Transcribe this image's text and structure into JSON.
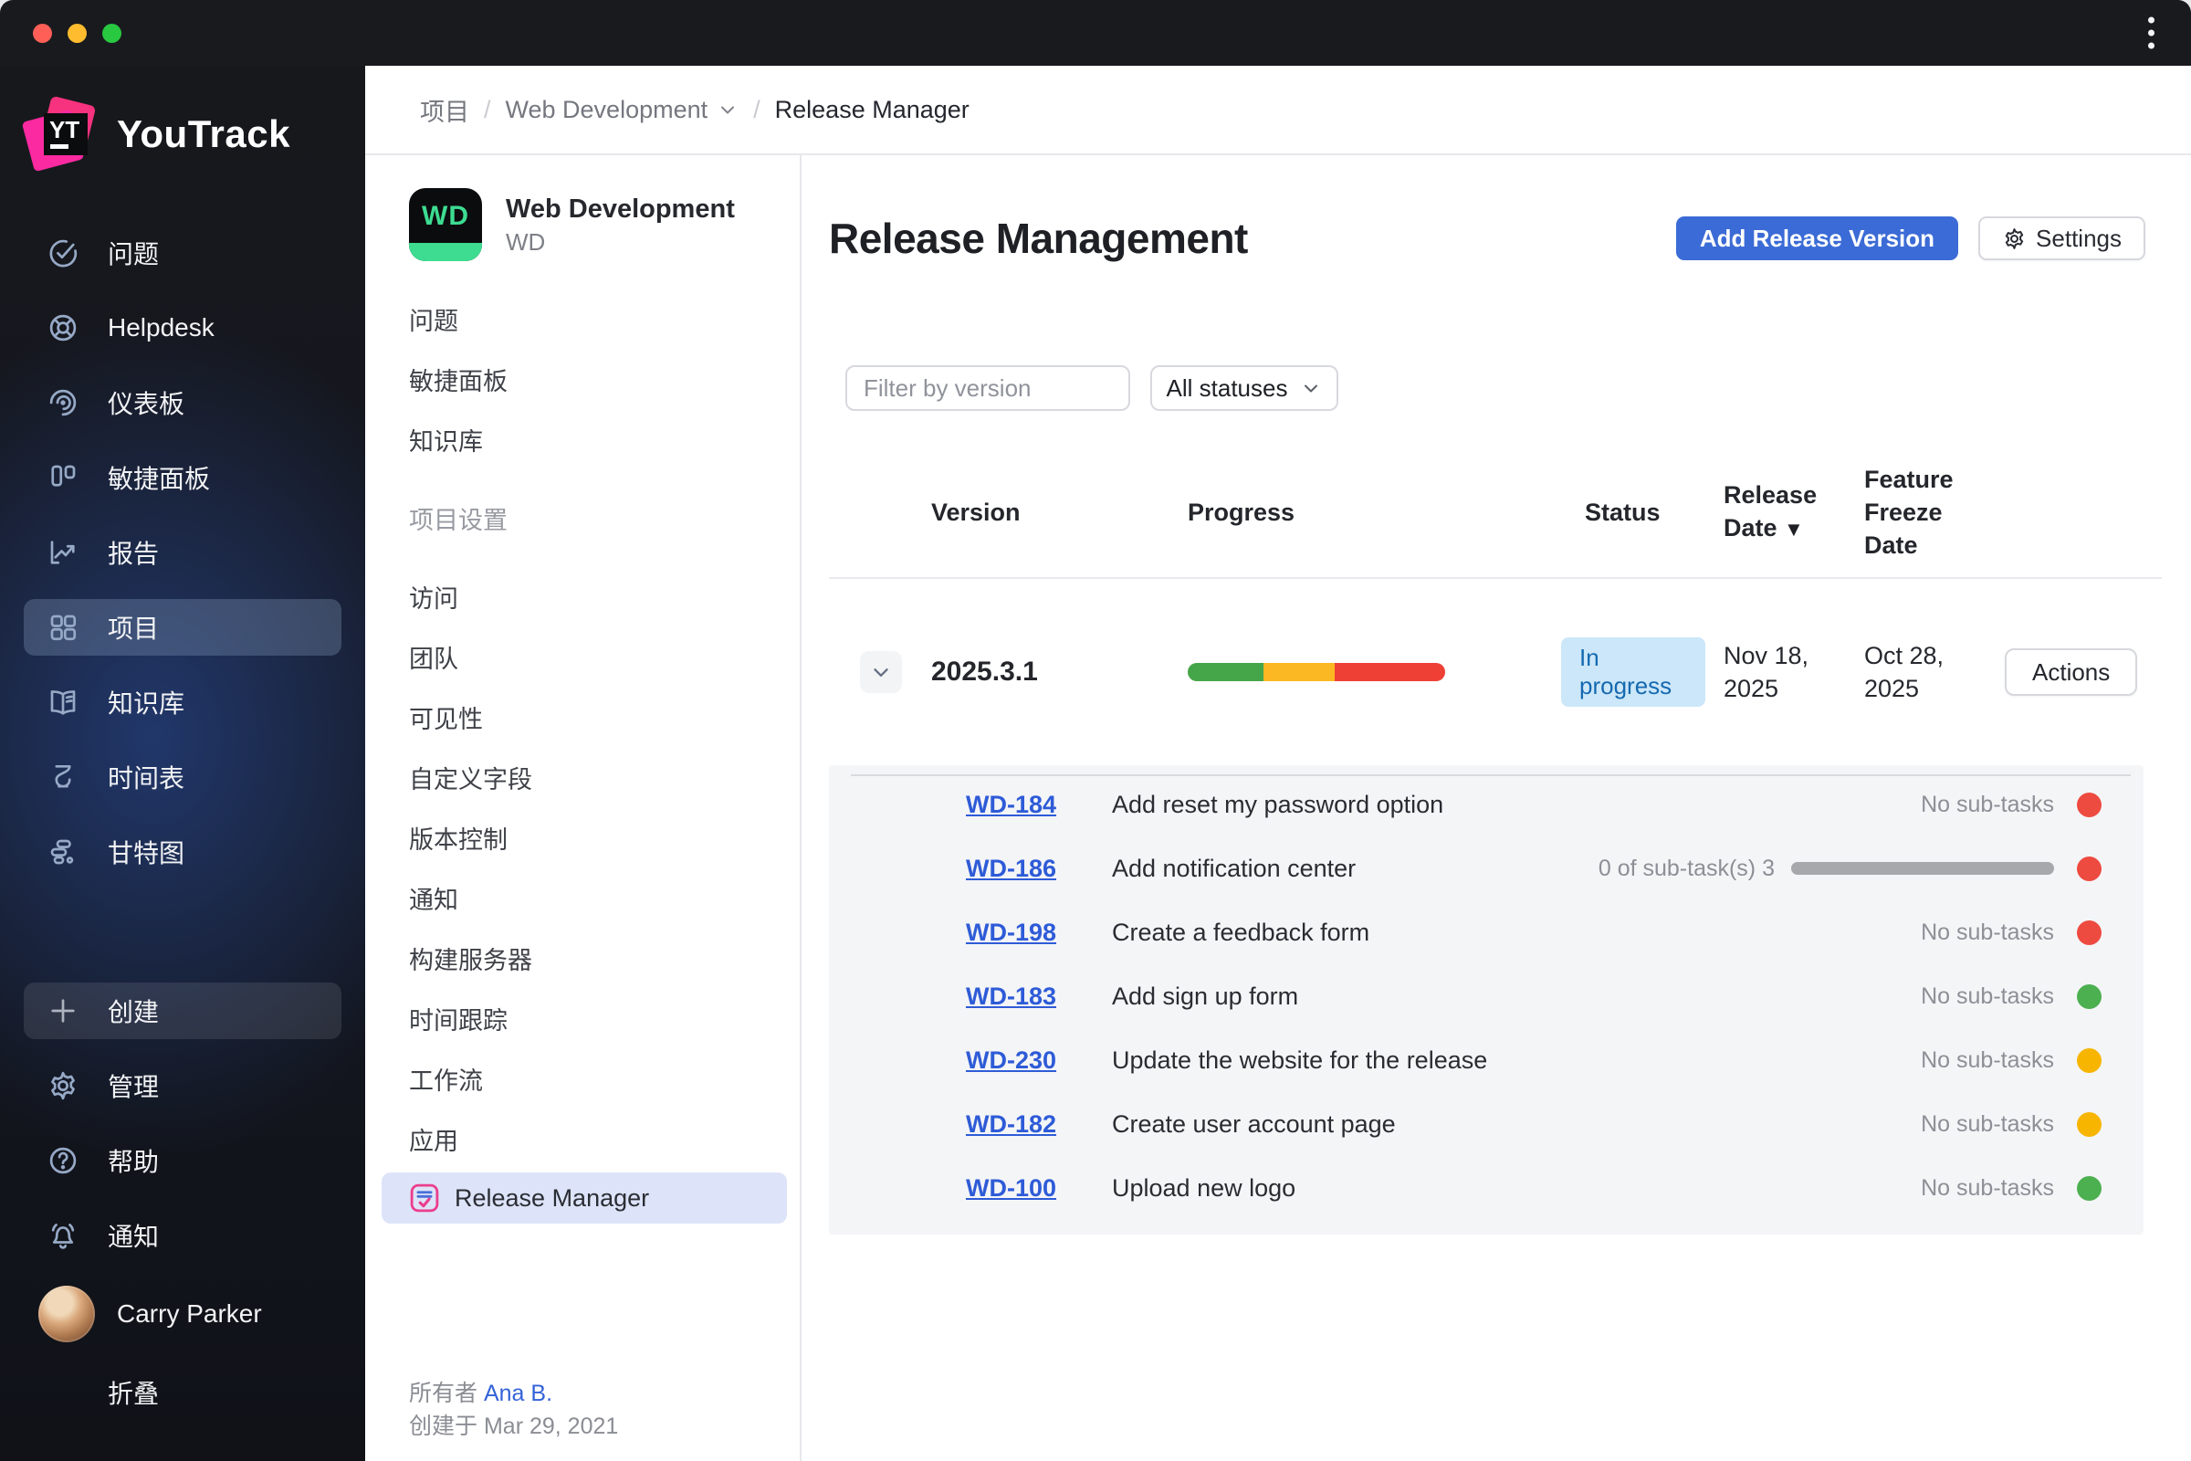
{
  "window": {
    "traffic_lights": [
      "#ff5f57",
      "#febc2e",
      "#28c840"
    ]
  },
  "app": {
    "name": "YouTrack",
    "logo_mark": "YT"
  },
  "sidebar": {
    "items": [
      {
        "icon": "check-circle",
        "label": "问题"
      },
      {
        "icon": "lifebuoy",
        "label": "Helpdesk"
      },
      {
        "icon": "dashboard-gauge",
        "label": "仪表板"
      },
      {
        "icon": "agile-board",
        "label": "敏捷面板"
      },
      {
        "icon": "report-chart",
        "label": "报告"
      },
      {
        "icon": "projects-grid",
        "label": "项目",
        "selected": true
      },
      {
        "icon": "knowledge-book",
        "label": "知识库"
      },
      {
        "icon": "hourglass",
        "label": "时间表"
      },
      {
        "icon": "gantt-bars",
        "label": "甘特图"
      }
    ],
    "footer_items": [
      {
        "icon": "plus",
        "label": "创建",
        "highlight": true
      },
      {
        "icon": "gear",
        "label": "管理"
      },
      {
        "icon": "question-circle",
        "label": "帮助"
      },
      {
        "icon": "bell",
        "label": "通知"
      }
    ],
    "user": {
      "name": "Carry Parker"
    },
    "collapse": {
      "icon": "collapse-chevrons",
      "label": "折叠"
    }
  },
  "breadcrumb": {
    "projects": "项目",
    "separator": "/",
    "project": "Web Development",
    "page": "Release Manager"
  },
  "project_panel": {
    "avatar_text": "WD",
    "name": "Web Development",
    "key": "WD",
    "nav_items": [
      {
        "label": "问题"
      },
      {
        "label": "敏捷面板"
      },
      {
        "label": "知识库"
      }
    ],
    "settings_section_title": "项目设置",
    "settings_items": [
      {
        "label": "访问"
      },
      {
        "label": "团队"
      },
      {
        "label": "可见性"
      },
      {
        "label": "自定义字段"
      },
      {
        "label": "版本控制"
      },
      {
        "label": "通知"
      },
      {
        "label": "构建服务器"
      },
      {
        "label": "时间跟踪"
      },
      {
        "label": "工作流"
      },
      {
        "label": "应用"
      }
    ],
    "selected_app": "Release Manager",
    "owner_label": "所有者",
    "owner_name": "Ana B.",
    "created_label": "创建于",
    "created_date": "Mar 29, 2021"
  },
  "main": {
    "title": "Release Management",
    "add_button": "Add Release Version",
    "settings_button": "Settings",
    "filter_placeholder": "Filter by version",
    "status_filter_value": "All statuses",
    "table": {
      "headers": {
        "version": "Version",
        "progress": "Progress",
        "status": "Status",
        "release_date": "Release Date",
        "sort_indicator": "▼",
        "feature_freeze": "Feature Freeze Date"
      },
      "release": {
        "version": "2025.3.1",
        "progress_segments": [
          {
            "color": "progress_green",
            "percent": 29.5
          },
          {
            "color": "progress_yellow",
            "percent": 27.5
          },
          {
            "color": "progress_red",
            "percent": 43
          }
        ],
        "status": "In progress",
        "release_date": "Nov 18, 2025",
        "feature_freeze_date": "Oct 28, 2025",
        "actions_label": "Actions"
      },
      "tasks": [
        {
          "id": "WD-184",
          "title": "Add reset my password option",
          "subtask_label": "No sub-tasks",
          "has_bar": false,
          "dot": "dot_red"
        },
        {
          "id": "WD-186",
          "title": "Add notification center",
          "subtask_label": "0 of sub-task(s) 3",
          "has_bar": true,
          "dot": "dot_red"
        },
        {
          "id": "WD-198",
          "title": "Create a feedback form",
          "subtask_label": "No sub-tasks",
          "has_bar": false,
          "dot": "dot_red"
        },
        {
          "id": "WD-183",
          "title": "Add sign up form",
          "subtask_label": "No sub-tasks",
          "has_bar": false,
          "dot": "dot_green"
        },
        {
          "id": "WD-230",
          "title": "Update the website for the release",
          "subtask_label": "No sub-tasks",
          "has_bar": false,
          "dot": "dot_yellow"
        },
        {
          "id": "WD-182",
          "title": "Create user account page",
          "subtask_label": "No sub-tasks",
          "has_bar": false,
          "dot": "dot_yellow"
        },
        {
          "id": "WD-100",
          "title": "Upload new logo",
          "subtask_label": "No sub-tasks",
          "has_bar": false,
          "dot": "dot_green"
        }
      ]
    }
  },
  "colors": {
    "accent_blue": "#3b6bd6",
    "badge_bg": "#cbe7f9",
    "badge_text": "#1569b0",
    "link_blue": "#2e5bd7",
    "progress_green": "#45a549",
    "progress_yellow": "#fcb822",
    "progress_red": "#ef4036",
    "dot_red": "#ee4b40",
    "dot_green": "#4caf50",
    "dot_yellow": "#f7b500",
    "subtask_bar_gray": "#a7a8ab",
    "project_green": "#3ddc91"
  }
}
